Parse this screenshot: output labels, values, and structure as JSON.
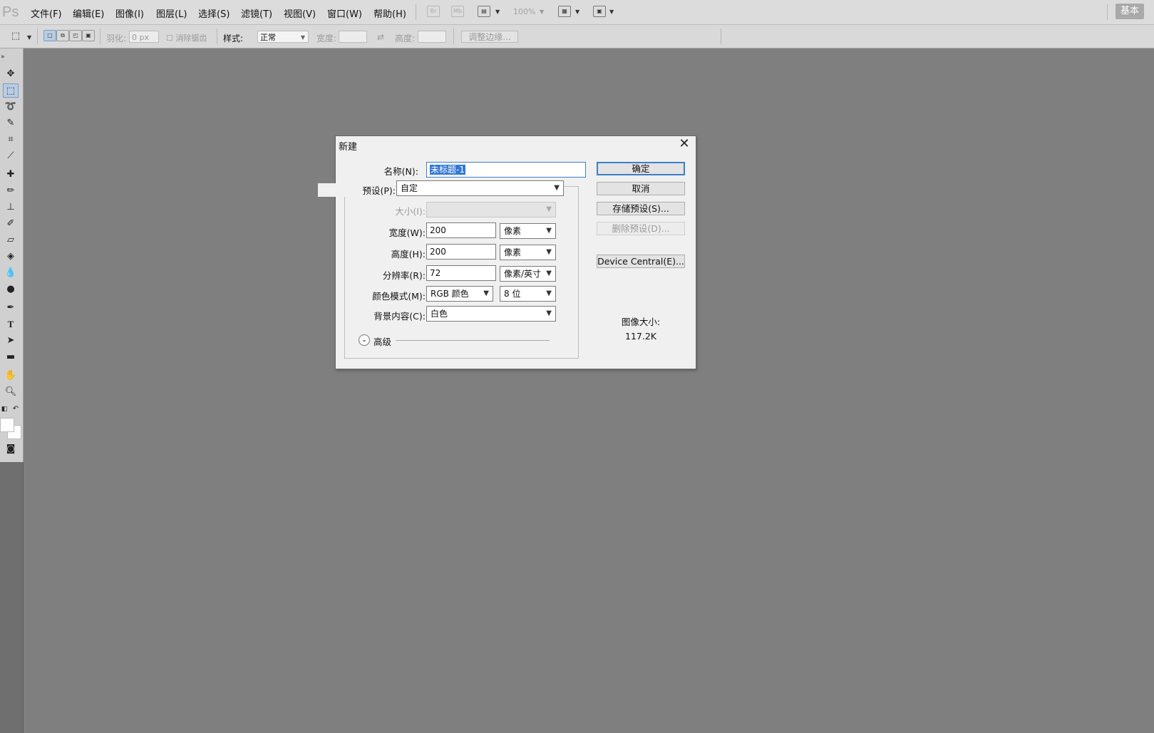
{
  "app": {
    "logo": "Ps",
    "menu": [
      "文件(F)",
      "编辑(E)",
      "图像(I)",
      "图层(L)",
      "选择(S)",
      "滤镜(T)",
      "视图(V)",
      "窗口(W)",
      "帮助(H)"
    ],
    "launch_br": "Br",
    "launch_mb": "Mb",
    "zoom": "100%",
    "workspace": "基本"
  },
  "options_bar": {
    "feather_label": "羽化:",
    "feather_value": "0 px",
    "antialias_label": "消除锯齿",
    "style_label": "样式:",
    "style_value": "正常",
    "width_label": "宽度:",
    "height_label": "高度:",
    "refine_edge": "调整边缘..."
  },
  "dialog": {
    "title": "新建",
    "name_label": "名称(N):",
    "name_value": "未标题-1",
    "preset_label": "预设(P):",
    "preset_value": "自定",
    "size_label": "大小(I):",
    "width_label": "宽度(W):",
    "width_value": "200",
    "width_unit": "像素",
    "height_label": "高度(H):",
    "height_value": "200",
    "height_unit": "像素",
    "resolution_label": "分辨率(R):",
    "resolution_value": "72",
    "resolution_unit": "像素/英寸",
    "color_mode_label": "颜色模式(M):",
    "color_mode_value": "RGB 颜色",
    "bit_depth_value": "8 位",
    "bg_label": "背景内容(C):",
    "bg_value": "白色",
    "advanced_label": "高级",
    "ok": "确定",
    "cancel": "取消",
    "save_preset": "存储预设(S)...",
    "delete_preset": "删除预设(D)...",
    "device_central": "Device Central(E)...",
    "image_size_label": "图像大小:",
    "image_size_value": "117.2K"
  },
  "colors": {
    "canvas_bg": "#7f7f7f",
    "selection": "#3277d6",
    "primary_button_border": "#3c7fc8"
  }
}
